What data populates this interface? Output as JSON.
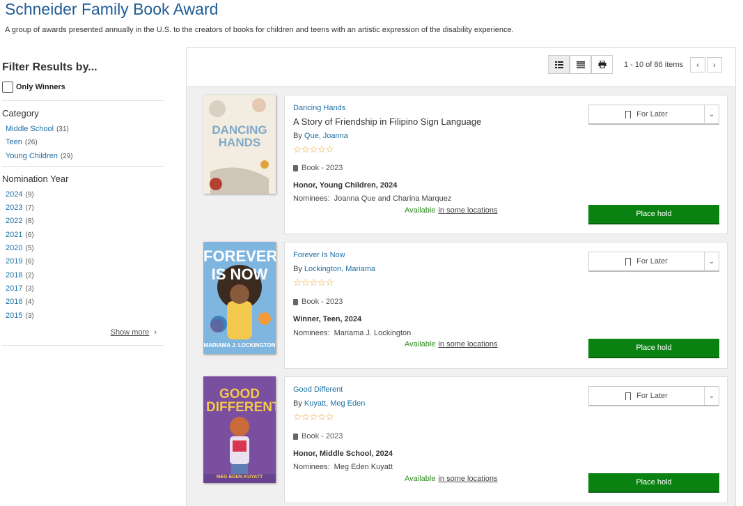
{
  "page": {
    "title": "Schneider Family Book Award",
    "description": "A group of awards presented annually in the U.S. to the creators of books for children and teens with an artistic expression of the disability experience."
  },
  "sidebar": {
    "heading": "Filter Results by...",
    "only_winners": "Only Winners",
    "category_heading": "Category",
    "categories": [
      {
        "label": "Middle School",
        "count": "(31)"
      },
      {
        "label": "Teen",
        "count": "(26)"
      },
      {
        "label": "Young Children",
        "count": "(29)"
      }
    ],
    "year_heading": "Nomination Year",
    "years": [
      {
        "label": "2024",
        "count": "(9)"
      },
      {
        "label": "2023",
        "count": "(7)"
      },
      {
        "label": "2022",
        "count": "(8)"
      },
      {
        "label": "2021",
        "count": "(6)"
      },
      {
        "label": "2020",
        "count": "(5)"
      },
      {
        "label": "2019",
        "count": "(6)"
      },
      {
        "label": "2018",
        "count": "(2)"
      },
      {
        "label": "2017",
        "count": "(3)"
      },
      {
        "label": "2016",
        "count": "(4)"
      },
      {
        "label": "2015",
        "count": "(3)"
      }
    ],
    "show_more": "Show more",
    "show_more_chevron": "›"
  },
  "toolbar": {
    "pager_text": "1 - 10 of 86 items",
    "prev": "‹",
    "next": "›"
  },
  "results": [
    {
      "series": "Dancing Hands",
      "subtitle": "A Story of Friendship in Filipino Sign Language",
      "by_label": "By",
      "author": "Que, Joanna",
      "stars": "☆☆☆☆☆",
      "format": "Book - 2023",
      "award": "Honor, Young Children, 2024",
      "nominees_label": "Nominees:",
      "nominees": "Joanna Que and Charina Marquez",
      "available": "Available",
      "locations": "in some locations",
      "for_later": "For Later",
      "place_hold": "Place hold",
      "cover_title": "DANCING HANDS",
      "cover_color": "#f3ece0",
      "cover_text_color": "#7fa9c9"
    },
    {
      "series": "Forever Is Now",
      "subtitle": "",
      "by_label": "By",
      "author": "Lockington, Mariama",
      "stars": "☆☆☆☆☆",
      "format": "Book - 2023",
      "award": "Winner, Teen, 2024",
      "nominees_label": "Nominees:",
      "nominees": "Mariama J. Lockington",
      "available": "Available",
      "locations": "in some locations",
      "for_later": "For Later",
      "place_hold": "Place hold",
      "cover_title": "FOREVER IS NOW",
      "cover_author": "MARIAMA J. LOCKINGTON",
      "cover_color": "#7fb6e0",
      "cover_text_color": "#ffffff"
    },
    {
      "series": "Good Different",
      "subtitle": "",
      "by_label": "By",
      "author": "Kuyatt, Meg Eden",
      "stars": "☆☆☆☆☆",
      "format": "Book - 2023",
      "award": "Honor, Middle School, 2024",
      "nominees_label": "Nominees:",
      "nominees": "Meg Eden Kuyatt",
      "available": "Available",
      "locations": "in some locations",
      "for_later": "For Later",
      "place_hold": "Place hold",
      "cover_title": "GOOD DIFFERENT",
      "cover_author": "MEG EDEN KUYATT",
      "cover_color": "#7b4fa0",
      "cover_text_color": "#f2c94c"
    }
  ]
}
